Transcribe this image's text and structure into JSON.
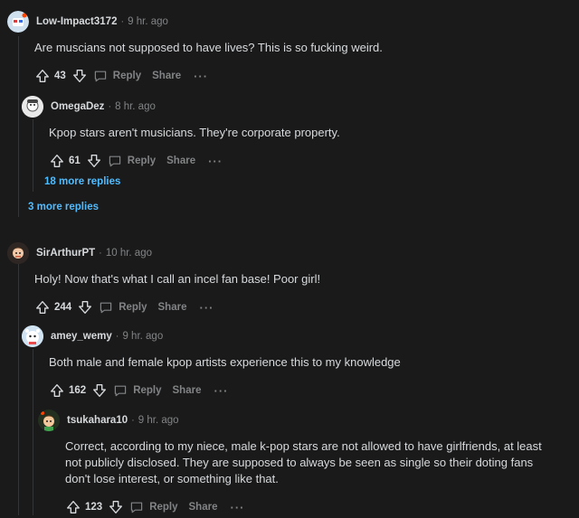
{
  "comments": [
    {
      "username": "Low-Impact3172",
      "time": "9 hr. ago",
      "body": "Are muscians not supposed to have lives? This is so fucking weird.",
      "score": "43",
      "reply_label": "Reply",
      "share_label": "Share"
    },
    {
      "username": "OmegaDez",
      "time": "8 hr. ago",
      "body": "Kpop stars aren't musicians. They're corporate property.",
      "score": "61",
      "reply_label": "Reply",
      "share_label": "Share"
    },
    {
      "username": "SirArthurPT",
      "time": "10 hr. ago",
      "body": "Holy! Now that's what I call an incel fan base! Poor girl!",
      "score": "244",
      "reply_label": "Reply",
      "share_label": "Share"
    },
    {
      "username": "amey_wemy",
      "time": "9 hr. ago",
      "body": "Both male and female kpop artists experience this to my knowledge",
      "score": "162",
      "reply_label": "Reply",
      "share_label": "Share"
    },
    {
      "username": "tsukahara10",
      "time": "9 hr. ago",
      "body": "Correct, according to my niece, male k-pop stars are not allowed to have girlfriends, at least not publicly disclosed. They are supposed to always be seen as single so their doting fans don't lose interest, or something like that.",
      "score": "123",
      "reply_label": "Reply",
      "share_label": "Share"
    }
  ],
  "more_replies": {
    "nested": "18 more replies",
    "top": "3 more replies"
  },
  "separator": "·",
  "more_glyph": "···",
  "colors": {
    "background": "#1a1a1b",
    "text": "#d7dadc",
    "meta": "#818384",
    "link": "#4fbcff",
    "thread_line": "#343536"
  }
}
